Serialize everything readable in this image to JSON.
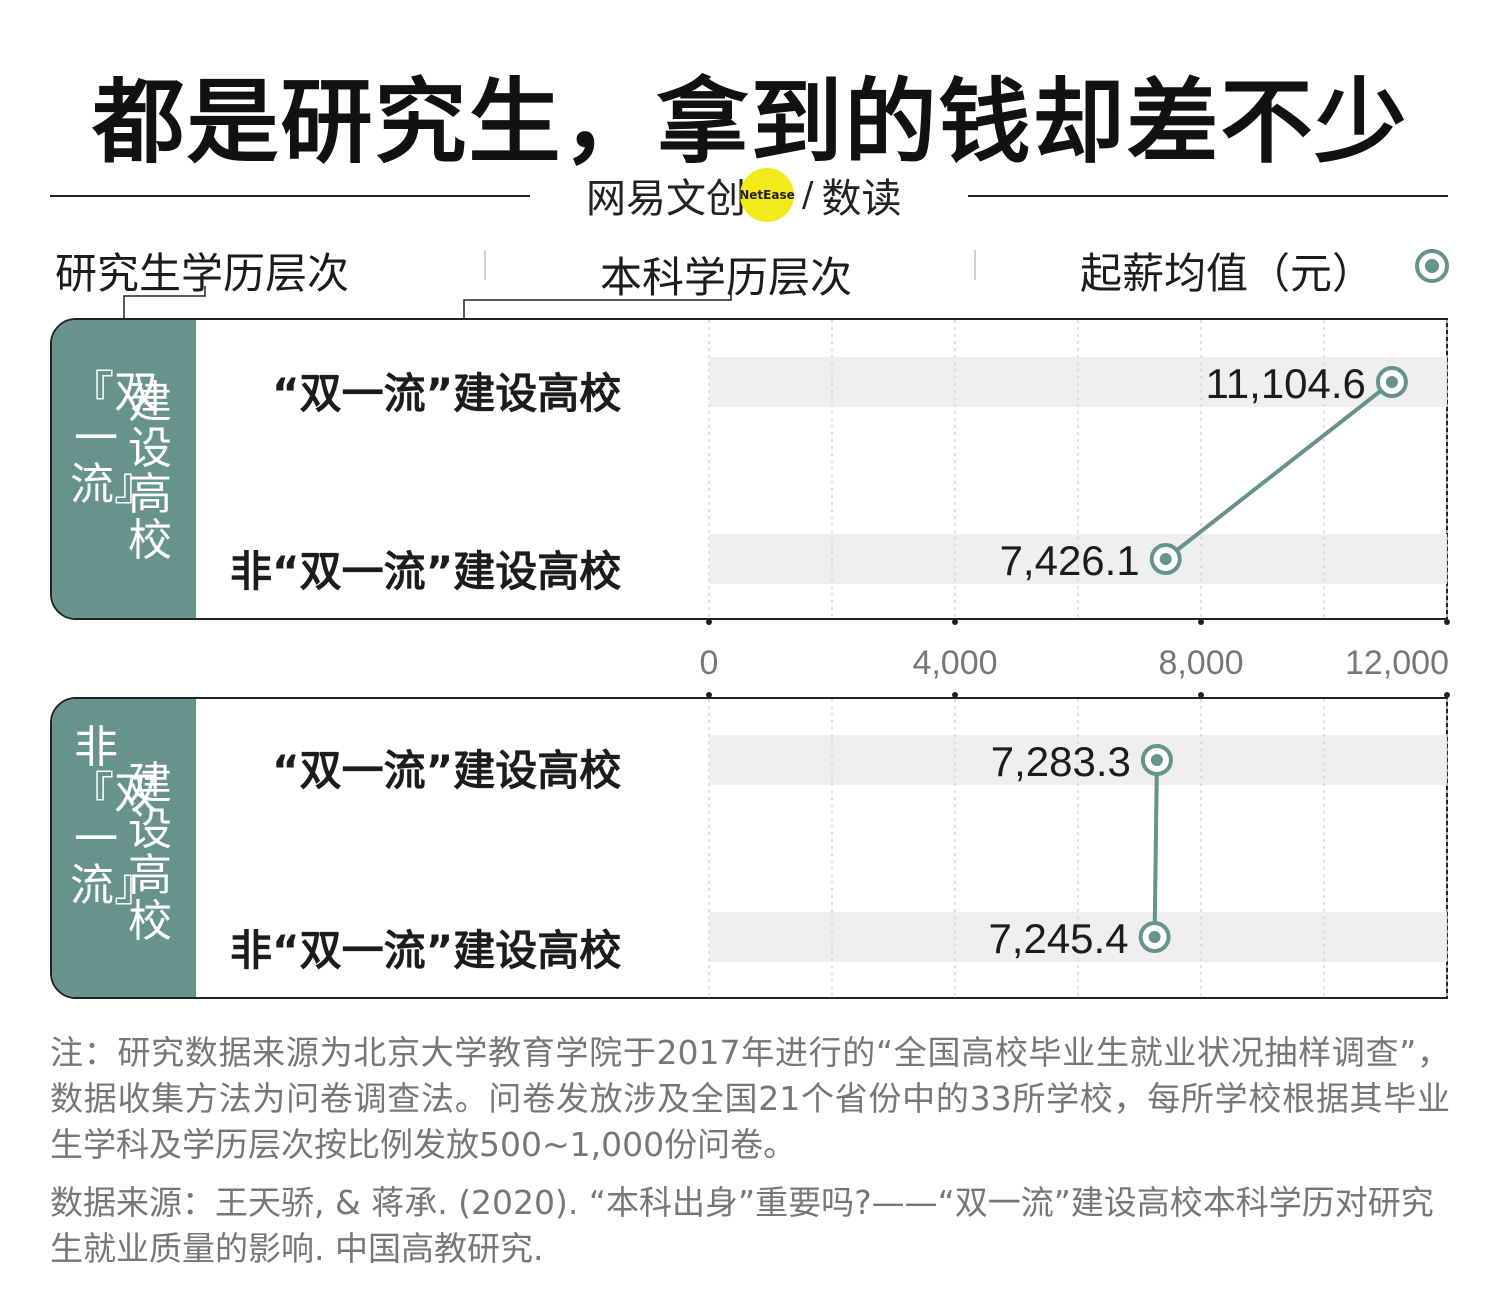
{
  "title": "都是研究生，拿到的钱却差不少",
  "logo": {
    "left": "网易文创",
    "badge": "NetEase",
    "right": "数读"
  },
  "headers": {
    "graduate_level": "研究生学历层次",
    "undergrad_level": "本科学历层次",
    "salary": "起薪均值（元）"
  },
  "colors": {
    "accent": "#66938c",
    "band": "#efefef",
    "text": "#1c1c1c",
    "note": "#777777"
  },
  "legend_icon": "target-dot-icon",
  "panels": [
    {
      "label_col1": "『双一流』",
      "label_col2": "建设高校",
      "rows": [
        "“双一流”建设高校",
        "非“双一流”建设高校"
      ]
    },
    {
      "label_col1": "非『双一流』",
      "label_col2": "建设高校",
      "rows": [
        "“双一流”建设高校",
        "非“双一流”建设高校"
      ]
    }
  ],
  "chart_data": {
    "type": "dot",
    "xlim": [
      0,
      12000
    ],
    "ticks": [
      0,
      4000,
      8000,
      12000
    ],
    "tick_labels": [
      "0",
      "4,000",
      "8,000",
      "12,000"
    ],
    "groups": [
      {
        "graduate": "“双一流”建设高校",
        "points": [
          {
            "undergrad": "“双一流”建设高校",
            "value": 11104.6,
            "label": "11,104.6"
          },
          {
            "undergrad": "非“双一流”建设高校",
            "value": 7426.1,
            "label": "7,426.1"
          }
        ]
      },
      {
        "graduate": "非“双一流”建设高校",
        "points": [
          {
            "undergrad": "“双一流”建设高校",
            "value": 7283.3,
            "label": "7,283.3"
          },
          {
            "undergrad": "非“双一流”建设高校",
            "value": 7245.4,
            "label": "7,245.4"
          }
        ]
      }
    ]
  },
  "note": "注：研究数据来源为北京大学教育学院于2017年进行的“全国高校毕业生就业状况抽样调查”，数据收集方法为问卷调查法。问卷发放涉及全国21个省份中的33所学校，每所学校根据其毕业生学科及学历层次按比例发放500~1,000份问卷。",
  "source": "数据来源：王天骄, & 蒋承. (2020). “本科出身”重要吗?——“双一流”建设高校本科学历对研究生就业质量的影响. 中国高教研究."
}
